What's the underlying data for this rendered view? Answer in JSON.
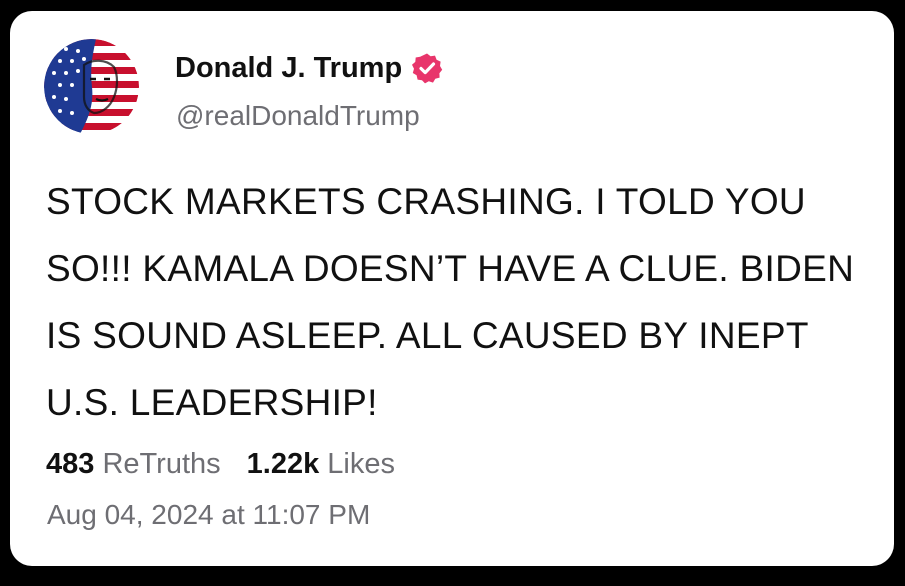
{
  "post": {
    "author": {
      "display_name": "Donald J. Trump",
      "handle": "@realDonaldTrump",
      "verified": true,
      "verified_icon": "verified-badge-icon",
      "verified_color": "#e8356b"
    },
    "text": "STOCK MARKETS CRASHING. I TOLD YOU SO!!! KAMALA DOESN’T HAVE A CLUE. BIDEN IS SOUND ASLEEP. ALL CAUSED BY INEPT U.S. LEADERSHIP!",
    "stats": {
      "retruths_count": "483",
      "retruths_label": "ReTruths",
      "likes_count": "1.22k",
      "likes_label": "Likes"
    },
    "timestamp": "Aug 04, 2024 at 11:07 PM"
  },
  "colors": {
    "background": "#000000",
    "card": "#ffffff",
    "primary_text": "#111111",
    "secondary_text": "#6e6e73",
    "flag_red": "#c8102e",
    "flag_blue": "#1f3a93"
  }
}
